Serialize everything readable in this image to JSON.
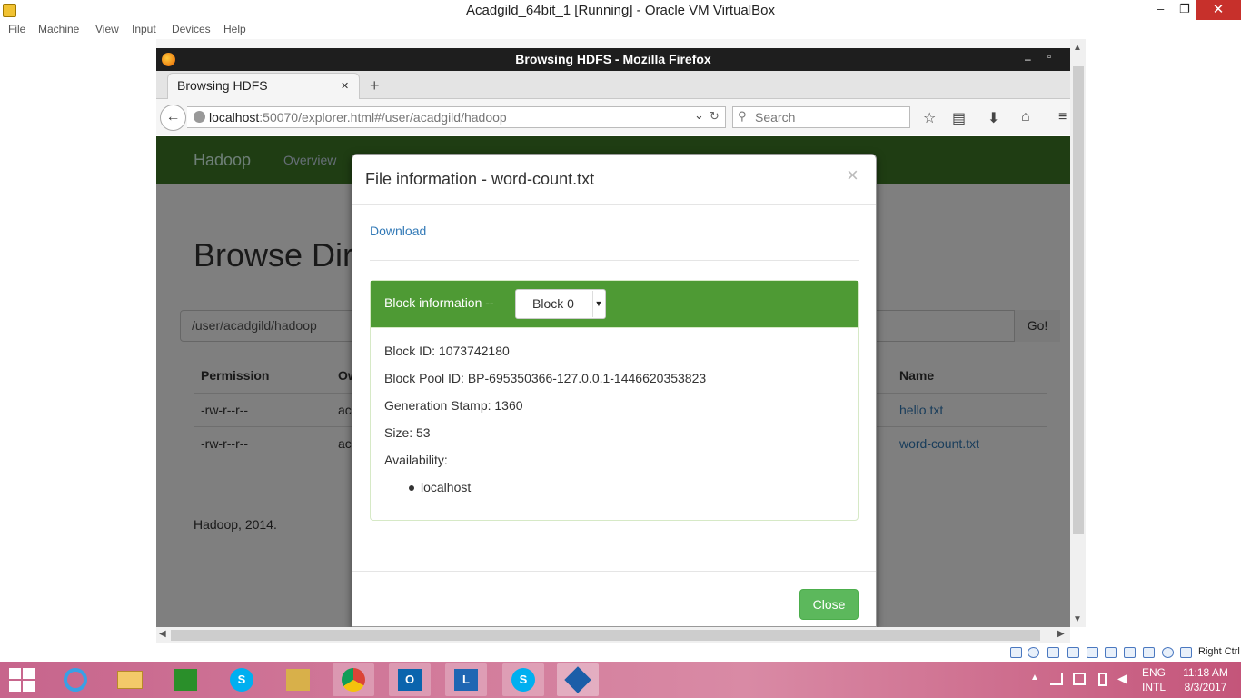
{
  "vbox": {
    "title": "Acadgild_64bit_1 [Running] - Oracle VM VirtualBox",
    "menu": [
      "File",
      "Machine",
      "View",
      "Input",
      "Devices",
      "Help"
    ],
    "minimize": "–",
    "restore": "❐",
    "close": "✕",
    "host_key": "Right Ctrl"
  },
  "firefox": {
    "window_title": "Browsing HDFS - Mozilla Firefox",
    "tab_label": "Browsing HDFS",
    "tab_close": "✕",
    "new_tab": "+",
    "url_host": "localhost",
    "url_rest": ":50070/explorer.html#/user/acadgild/hadoop",
    "search_placeholder": "Search"
  },
  "page": {
    "brand": "Hadoop",
    "nav_overview": "Overview",
    "heading": "Browse Dir",
    "path_value": "/user/acadgild/hadoop",
    "go_button": "Go!",
    "columns": {
      "permission": "Permission",
      "owner": "Ow",
      "name": "Name"
    },
    "rows": [
      {
        "permission": "-rw-r--r--",
        "owner": "ac",
        "name": "hello.txt"
      },
      {
        "permission": "-rw-r--r--",
        "owner": "ac",
        "name": "word-count.txt"
      }
    ],
    "footer": "Hadoop, 2014."
  },
  "modal": {
    "title": "File information - word-count.txt",
    "close_x": "×",
    "download": "Download",
    "block_info_label": "Block information --",
    "block_selected": "Block 0",
    "block_id": "Block ID: 1073742180",
    "block_pool": "Block Pool ID: BP-695350366-127.0.0.1-1446620353823",
    "gen_stamp": "Generation Stamp: 1360",
    "size": "Size: 53",
    "availability": "Availability:",
    "hosts": [
      "localhost"
    ],
    "close_button": "Close"
  },
  "taskbar": {
    "lang": "ENG",
    "layout": "INTL",
    "time": "11:18 AM",
    "date": "8/3/2017"
  },
  "colors": {
    "hadoop_green": "#3f7a27",
    "panel_green": "#4e9a34",
    "link_blue": "#337ab7",
    "close_green": "#5cb85c"
  }
}
